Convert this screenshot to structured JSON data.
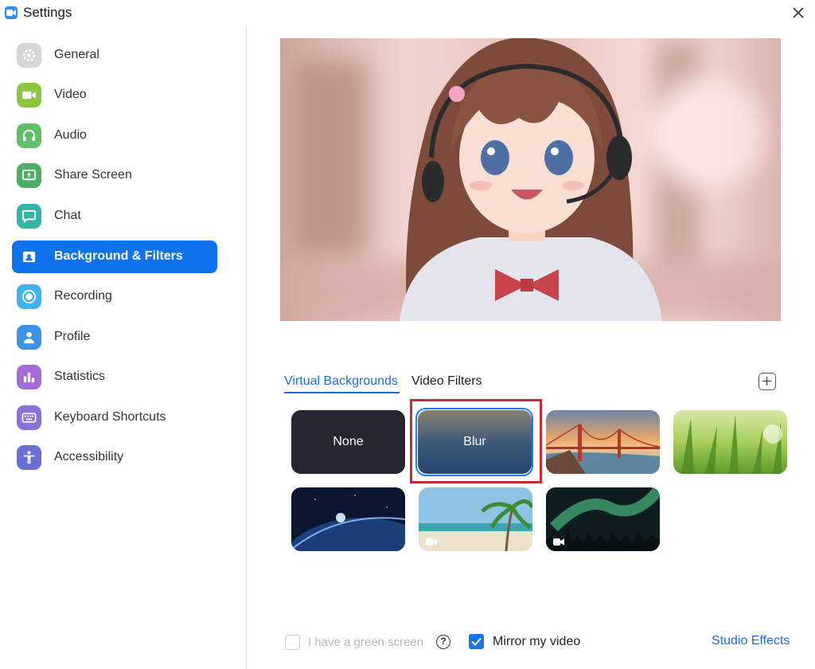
{
  "window": {
    "title": "Settings"
  },
  "colors": {
    "accent": "#0e72ed",
    "link": "#1b6fd8",
    "highlight": "#c72a35"
  },
  "sidebar": {
    "items": [
      {
        "label": "General",
        "icon": "gear-icon",
        "color": "#d6d6d6"
      },
      {
        "label": "Video",
        "icon": "video-camera-icon",
        "color": "#8cc63f"
      },
      {
        "label": "Audio",
        "icon": "headphones-icon",
        "color": "#5fbf68"
      },
      {
        "label": "Share Screen",
        "icon": "share-screen-icon",
        "color": "#4caf63"
      },
      {
        "label": "Chat",
        "icon": "chat-bubble-icon",
        "color": "#33b5a5"
      },
      {
        "label": "Background & Filters",
        "icon": "background-icon",
        "color": "#0e72ed",
        "active": true
      },
      {
        "label": "Recording",
        "icon": "record-icon",
        "color": "#3db4f0"
      },
      {
        "label": "Profile",
        "icon": "person-icon",
        "color": "#3b93e8"
      },
      {
        "label": "Statistics",
        "icon": "bar-chart-icon",
        "color": "#a56bd8"
      },
      {
        "label": "Keyboard Shortcuts",
        "icon": "keyboard-icon",
        "color": "#8a72d8"
      },
      {
        "label": "Accessibility",
        "icon": "accessibility-icon",
        "color": "#6a6fd8"
      }
    ]
  },
  "tabs": [
    {
      "label": "Virtual Backgrounds",
      "active": true
    },
    {
      "label": "Video Filters",
      "active": false
    }
  ],
  "backgrounds": [
    {
      "label": "None"
    },
    {
      "label": "Blur",
      "selected": true
    },
    {
      "label": ""
    },
    {
      "label": ""
    },
    {
      "label": ""
    },
    {
      "label": ""
    },
    {
      "label": ""
    }
  ],
  "footer": {
    "green_screen_label": "I have a green screen",
    "green_screen_checked": false,
    "mirror_label": "Mirror my video",
    "mirror_checked": true,
    "studio_effects_label": "Studio Effects"
  }
}
